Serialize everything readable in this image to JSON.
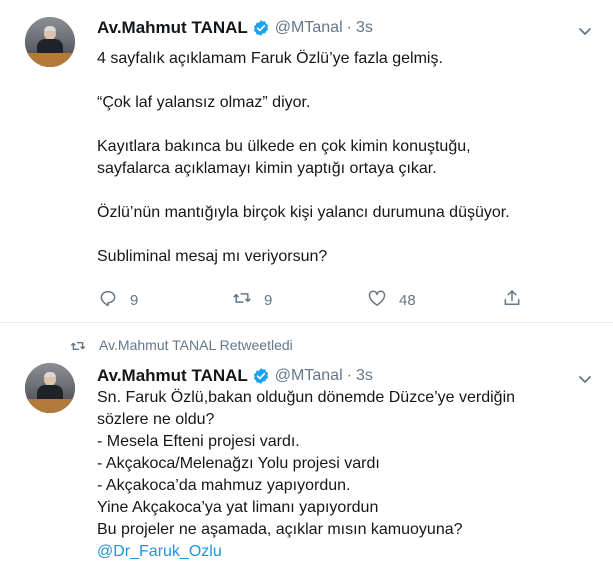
{
  "tweet1": {
    "author_name": "Av.Mahmut TANAL",
    "handle": "@MTanal",
    "separator": "·",
    "time": "3s",
    "lines": [
      "4 sayfalık açıklamam Faruk Özlü’ye fazla gelmiş.",
      "",
      "“Çok laf yalansız olmaz” diyor.",
      "",
      "Kayıtlara bakınca bu ülkede en çok kimin konuştuğu,",
      "sayfalarca açıklamayı kimin yaptığı ortaya çıkar.",
      "",
      "Özlü’nün mantığıyla birçok kişi yalancı durumuna düşüyor.",
      "",
      "Subliminal mesaj mı veriyorsun?"
    ],
    "reply_count": "9",
    "retweet_count": "9",
    "like_count": "48"
  },
  "tweet2": {
    "retweeted_by": "Av.Mahmut TANAL Retweetledi",
    "author_name": "Av.Mahmut TANAL",
    "handle": "@MTanal",
    "separator": "·",
    "time": "3s",
    "lines": [
      "Sn. Faruk Özlü,bakan olduğun dönemde Düzce’ye verdiğin",
      "sözlere ne oldu?",
      "- Mesela Efteni projesi vardı.",
      "- Akçakoca/Melenağzı Yolu projesi vardı",
      "- Akçakoca’da mahmuz yapıyordun.",
      "Yine Akçakoca’ya yat limanı yapıyordun",
      "Bu projeler ne aşamada, açıklar mısın kamuoyuna?"
    ],
    "mention": "@Dr_Faruk_Ozlu"
  },
  "colors": {
    "link": "#1b95e0",
    "verified": "#1da1f2",
    "muted": "#657786",
    "text": "#14171a"
  },
  "icons": [
    "verified-badge-icon",
    "chevron-down-icon",
    "reply-icon",
    "retweet-icon",
    "like-icon",
    "share-icon"
  ]
}
